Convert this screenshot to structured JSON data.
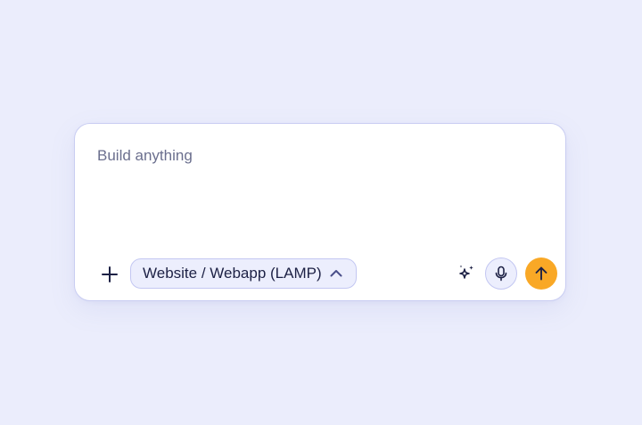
{
  "composer": {
    "placeholder": "Build anything",
    "value": "",
    "mode_label": "Website / Webapp (LAMP)",
    "icons": {
      "add": "plus-icon",
      "mode_toggle": "chevron-up-icon",
      "enhance": "sparkle-icon",
      "voice": "microphone-icon",
      "send": "arrow-up-icon"
    }
  },
  "colors": {
    "background": "#ebedfc",
    "card": "#ffffff",
    "accent": "#f9a826",
    "chip_bg": "#eceefd",
    "text_dark": "#1d2145",
    "placeholder": "#6b6f8e"
  }
}
